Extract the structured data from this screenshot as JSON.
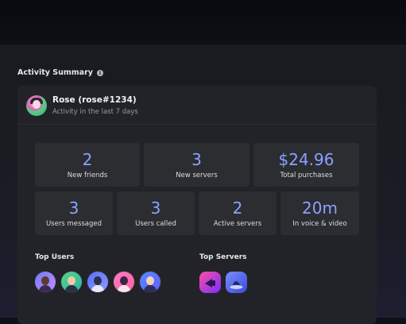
{
  "section": {
    "title": "Activity Summary",
    "info_icon": "info-icon"
  },
  "user": {
    "name": "Rose (rose#1234)",
    "subtitle": "Activity in the last 7 days",
    "avatar": "avatar"
  },
  "stats_row1": [
    {
      "value": "2",
      "label": "New friends"
    },
    {
      "value": "3",
      "label": "New servers"
    },
    {
      "value": "$24.96",
      "label": "Total purchases"
    }
  ],
  "stats_row2": [
    {
      "value": "3",
      "label": "Users messaged"
    },
    {
      "value": "3",
      "label": "Users called"
    },
    {
      "value": "2",
      "label": "Active servers"
    },
    {
      "value": "20m",
      "label": "In voice & video"
    }
  ],
  "top_users": {
    "title": "Top Users",
    "count": 5
  },
  "top_servers": {
    "title": "Top Servers",
    "count": 2
  },
  "colors": {
    "accent": "#8ea1ff",
    "card": "#222328",
    "tile": "#2b2d31"
  }
}
